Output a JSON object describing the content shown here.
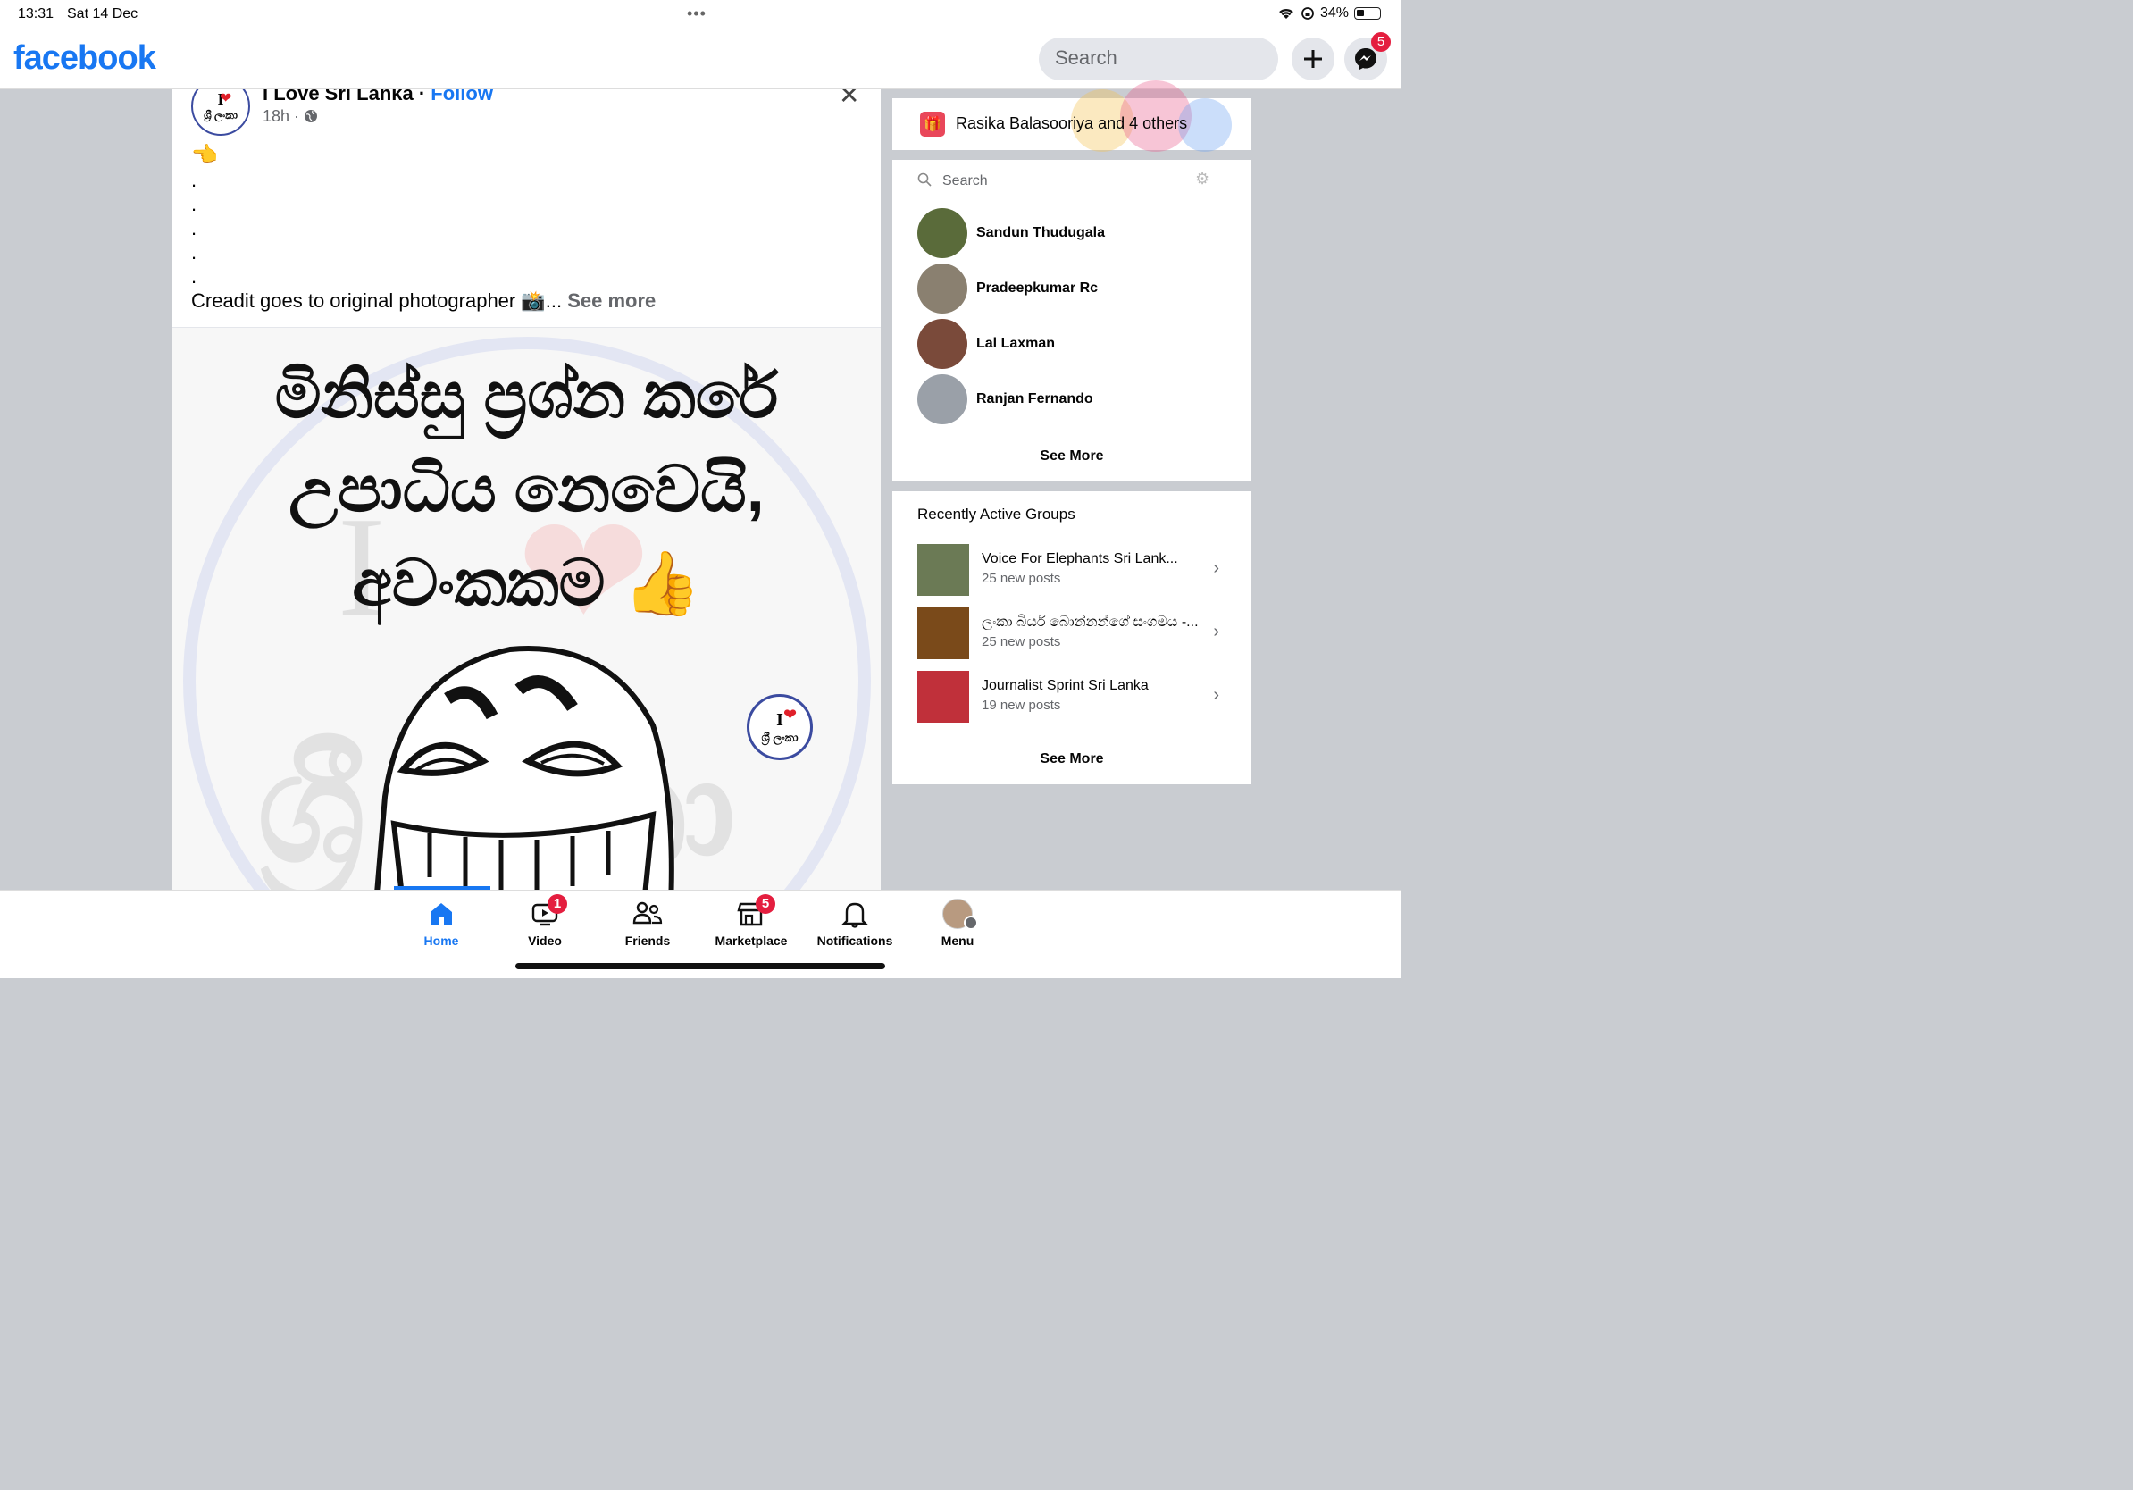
{
  "status_bar": {
    "time": "13:31",
    "date": "Sat 14 Dec",
    "battery": "34%",
    "battery_level": 0.34
  },
  "header": {
    "logo": "facebook",
    "search_placeholder": "Search",
    "messenger_badge": "5"
  },
  "post": {
    "page_name": "I Love Sri Lanka",
    "separator": " · ",
    "follow_label": "Follow",
    "time": "18h · ",
    "avatar_text_top": "I",
    "avatar_text_bottom": "ශ්‍රී ලංකා",
    "pointing_emoji": "👈",
    "dots": [
      ".",
      ".",
      ".",
      ".",
      "."
    ],
    "caption": "Creadit goes to original photographer 📸",
    "ellipsis": "... ",
    "see_more": "See more",
    "image": {
      "line1": "මිනිස්සු ප්‍රශ්න කරේ",
      "line2": "උපාධිය නෙවෙයි,",
      "line3": "අවංකකම",
      "thumb": "👍",
      "logo_top": "I",
      "logo_bottom": "ශ්‍රී ලංකා"
    }
  },
  "birthday": {
    "name": "Rasika Balasooriya",
    "connector": " and ",
    "others": "4 others"
  },
  "contacts": {
    "search_placeholder": "Search",
    "items": [
      {
        "name": "Sandun Thudugala",
        "color": "#5a6b3a"
      },
      {
        "name": "Pradeepkumar Rc",
        "color": "#8a8070"
      },
      {
        "name": "Lal Laxman",
        "color": "#7a4a3a"
      },
      {
        "name": "Ranjan Fernando",
        "color": "#9aa0a8"
      }
    ],
    "see_more": "See More"
  },
  "groups": {
    "title": "Recently Active Groups",
    "items": [
      {
        "name": "Voice For Elephants Sri Lank...",
        "sub": "25 new posts",
        "color": "#6b7a55"
      },
      {
        "name": "ලංකා බියර් බොන්නන්ගේ සංගමය -...",
        "sub": "25 new posts",
        "color": "#7a4a1a"
      },
      {
        "name": "Journalist Sprint Sri Lanka",
        "sub": "19 new posts",
        "color": "#c0303a"
      }
    ],
    "see_more": "See More"
  },
  "tabs": [
    {
      "label": "Home",
      "badge": ""
    },
    {
      "label": "Video",
      "badge": "1"
    },
    {
      "label": "Friends",
      "badge": ""
    },
    {
      "label": "Marketplace",
      "badge": "5"
    },
    {
      "label": "Notifications",
      "badge": ""
    },
    {
      "label": "Menu",
      "badge": ""
    }
  ],
  "colors": {
    "brand": "#1877f2",
    "badge": "#e41e3f",
    "background": "#c9ccd1"
  }
}
